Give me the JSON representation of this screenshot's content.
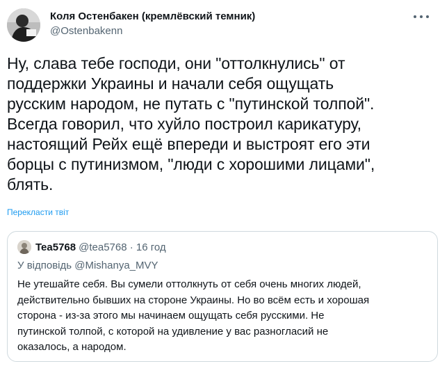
{
  "tweet": {
    "author": {
      "display_name": "Коля Остенбакен (кремлёвский темник)",
      "handle": "@Ostenbakenn"
    },
    "text": "Ну, слава тебе господи, они \"оттолкнулись\" от\nподдержки Украины и начали себя ощущать\nрусским народом, не путать с \"путинской толпой\".\nВсегда говорил, что хуйло построил карикатуру,\nнастоящий Рейх ещё впереди и выстроят его эти\nборцы с путинизмом, \"люди с хорошими лицами\",\nблять.",
    "translate_label": "Перекласти твіт",
    "more_icon": "more-icon"
  },
  "quoted_tweet": {
    "author_name": "Tea5768",
    "handle": "@tea5768",
    "separator": " · ",
    "time": "16 год",
    "reply_to": "У відповідь @Mishanya_MVY",
    "text": "Не утешайте себя. Вы сумели оттолкнуть от себя очень многих людей,\nдействительно бывших на стороне Украины. Но во всём есть и хорошая\nсторона - из-за этого мы начинаем ощущать себя русскими. Не\nпутинской толпой, с  которой на удивление у вас разногласий не\nоказалось, а народом."
  },
  "colors": {
    "text": "#0f1419",
    "secondary": "#536471",
    "link": "#1d9bf0",
    "border": "#cfd9de"
  }
}
